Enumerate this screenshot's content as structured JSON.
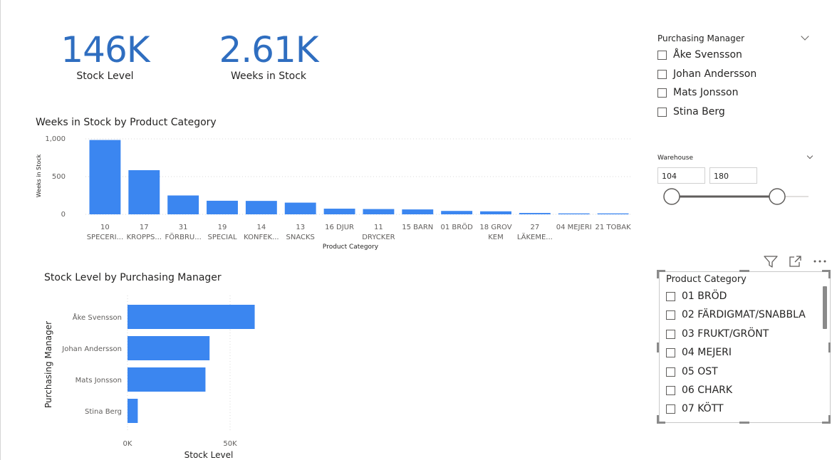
{
  "kpis": [
    {
      "value": "146K",
      "label": "Stock Level"
    },
    {
      "value": "2.61K",
      "label": "Weeks in Stock"
    }
  ],
  "weeks_chart": {
    "title": "Weeks in Stock by Product Category",
    "xlabel": "Product Category",
    "ylabel": "Weeks in Stock"
  },
  "stock_chart": {
    "title": "Stock Level by Purchasing Manager",
    "xlabel": "Stock Level",
    "ylabel": "Purchasing Manager"
  },
  "chart_data": [
    {
      "type": "bar",
      "title": "Weeks in Stock by Product Category",
      "xlabel": "Product Category",
      "ylabel": "Weeks in Stock",
      "categories": [
        [
          "10",
          "SPECERI..."
        ],
        [
          "17",
          "KROPPS..."
        ],
        [
          "31",
          "FÖRBRU..."
        ],
        [
          "19",
          "SPECIAL"
        ],
        [
          "14",
          "KONFEK..."
        ],
        [
          "13",
          "SNACKS"
        ],
        [
          "16 DJUR"
        ],
        [
          "11",
          "DRYCKER"
        ],
        [
          "15 BARN"
        ],
        [
          "01 BRÖD"
        ],
        [
          "18 GROV",
          "KEM"
        ],
        [
          "27",
          "LÄKEME..."
        ],
        [
          "04 MEJERI"
        ],
        [
          "21 TOBAK"
        ]
      ],
      "values": [
        985,
        585,
        250,
        180,
        178,
        155,
        75,
        70,
        65,
        45,
        40,
        18,
        12,
        12
      ],
      "yticks": [
        "0",
        "500",
        "1,000"
      ],
      "ylim": [
        0,
        1000
      ],
      "grid": true,
      "color": "#3b86f0"
    },
    {
      "type": "bar",
      "orientation": "horizontal",
      "title": "Stock Level by Purchasing Manager",
      "xlabel": "Stock Level",
      "ylabel": "Purchasing Manager",
      "categories": [
        "Åke Svensson",
        "Johan Andersson",
        "Mats Jonsson",
        "Stina Berg"
      ],
      "values": [
        62000,
        40000,
        38000,
        5000
      ],
      "xticks": [
        "0K",
        "50K"
      ],
      "xlim": [
        0,
        75000
      ],
      "grid": true,
      "color": "#3b86f0"
    }
  ],
  "purchasing_slicer": {
    "title": "Purchasing Manager",
    "items": [
      "Åke Svensson",
      "Johan Andersson",
      "Mats Jonsson",
      "Stina Berg"
    ]
  },
  "warehouse_slicer": {
    "title": "Warehouse",
    "min": "104",
    "max": "180"
  },
  "category_slicer": {
    "title": "Product Category",
    "items": [
      "01 BRÖD",
      "02 FÄRDIGMAT/SNABBLA",
      "03 FRUKT/GRÖNT",
      "04 MEJERI",
      "05 OST",
      "06 CHARK",
      "07 KÖTT"
    ]
  },
  "visual_header_icons": [
    "filter-icon",
    "focus-mode-icon",
    "more-options-icon"
  ]
}
